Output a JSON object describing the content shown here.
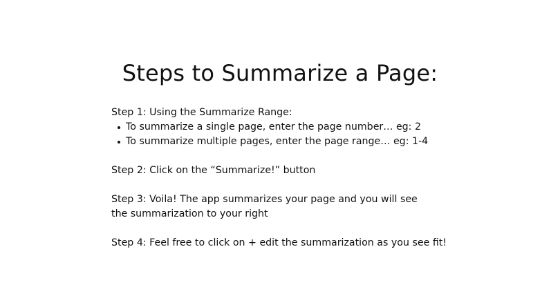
{
  "title": "Steps to Summarize a Page:",
  "steps": [
    {
      "text": "Step 1: Using the Summarize Range:",
      "bullets": [
        "To summarize a single page, enter the page number… eg: 2",
        "To summarize multiple pages, enter the page range… eg: 1-4"
      ]
    },
    {
      "text": "Step 2: Click on the “Summarize!” button"
    },
    {
      "text": "Step 3: Voila! The app summarizes your page and you will see the summarization to your right"
    },
    {
      "text": "Step 4: Feel free to click on + edit the summarization as you see fit!"
    }
  ]
}
